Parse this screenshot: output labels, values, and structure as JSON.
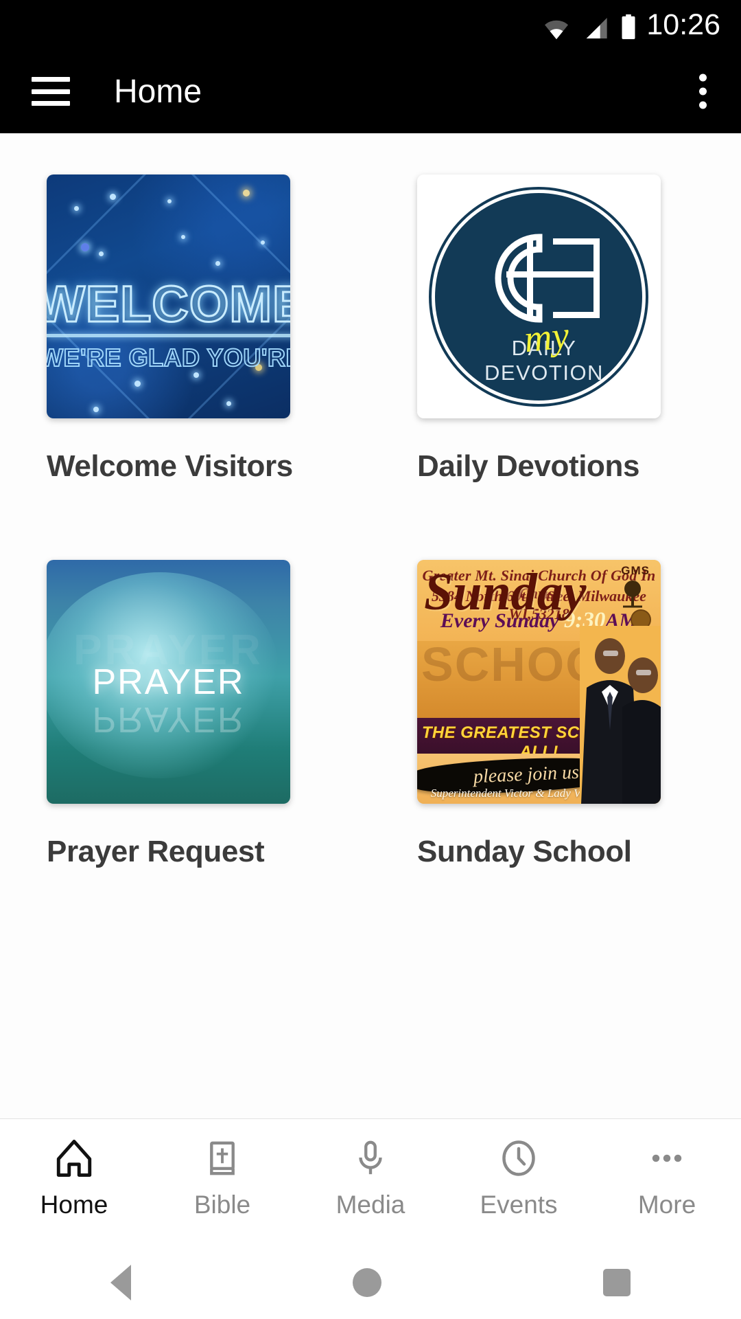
{
  "status_bar": {
    "time": "10:26",
    "icons": [
      "wifi-icon",
      "cellular-signal-icon",
      "battery-icon"
    ]
  },
  "app_bar": {
    "menu_icon": "hamburger-menu-icon",
    "title": "Home",
    "overflow_icon": "overflow-menu-icon"
  },
  "home_grid": {
    "items": [
      {
        "label": "Welcome Visitors",
        "thumbnail": {
          "name": "welcome-visitors-thumbnail",
          "headline": "WELCOME",
          "subline": "WE'RE GLAD YOU'RE HERE",
          "bg_color": "#11498f"
        }
      },
      {
        "label": "Daily Devotions",
        "thumbnail": {
          "name": "daily-devotions-thumbnail",
          "script_word": "my",
          "wordmark": "DAILY DEVOTION",
          "bg_color": "#123a56",
          "accent_color": "#f2f237"
        }
      },
      {
        "label": "Prayer Request",
        "thumbnail": {
          "name": "prayer-request-thumbnail",
          "headline": "PRAYER",
          "bg_color": "#3fa0a8"
        }
      },
      {
        "label": "Sunday School",
        "thumbnail": {
          "name": "sunday-school-thumbnail",
          "church_name": "Greater Mt. Sinai  Church Of God In Christ",
          "address": "5384 North 60th Street Milwaukee WI,53218",
          "schedule_prefix": "Every Sunday ",
          "schedule_time": "9:30",
          "schedule_suffix": "AM",
          "big_word": "Sunday",
          "monogram": "GMS",
          "tagline": "THE GREATEST SCHOOL OF ALL!",
          "ribbon": "please join us",
          "credit": "Superintendent Victor  & Lady  Vannessa Davis",
          "bg_color": "#f3b64e"
        }
      }
    ]
  },
  "tab_bar": {
    "tabs": [
      {
        "label": "Home",
        "icon": "home-church-icon",
        "active": true
      },
      {
        "label": "Bible",
        "icon": "bible-book-icon",
        "active": false
      },
      {
        "label": "Media",
        "icon": "microphone-icon",
        "active": false
      },
      {
        "label": "Events",
        "icon": "clock-icon",
        "active": false
      },
      {
        "label": "More",
        "icon": "more-dots-icon",
        "active": false
      }
    ]
  },
  "system_nav": {
    "back": "back-triangle-icon",
    "home": "home-circle-icon",
    "recents": "recents-square-icon"
  }
}
